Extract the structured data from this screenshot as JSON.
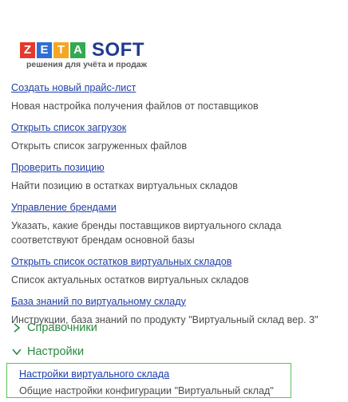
{
  "logo": {
    "letters": [
      "Z",
      "E",
      "T",
      "A"
    ],
    "word": "SOFT",
    "tagline": "решения для учёта и продаж",
    "letter_colors": [
      "#e23b2e",
      "#2e6fd8",
      "#f5a623",
      "#34a853"
    ]
  },
  "items": [
    {
      "link": "Создать новый прайс-лист",
      "desc": "Новая настройка получения файлов от поставщиков"
    },
    {
      "link": "Открыть список загрузок",
      "desc": "Открыть список загруженных файлов"
    },
    {
      "link": "Проверить позицию",
      "desc": "Найти позицию в остатках виртуальных складов"
    },
    {
      "link": "Управление брендами",
      "desc": "Указать, какие бренды поставщиков виртуального склада",
      "desc2": "соответствуют брендам основной базы"
    },
    {
      "link": "Открыть список остатков виртуальных складов",
      "desc": "Список актуальных остатков виртуальных складов"
    },
    {
      "link": "База знаний по виртуальному складу",
      "desc": "Инструкции, база знаний по продукту \"Виртуальный склад вер. 3\""
    }
  ],
  "groups": [
    {
      "label": "Справочники",
      "state": "collapsed"
    },
    {
      "label": "Настройки",
      "state": "expanded"
    }
  ],
  "settings_item": {
    "link": "Настройки виртуального склада",
    "desc": "Общие настройки конфигурации \"Виртуальный склад\""
  },
  "colors": {
    "link": "#1f3faa",
    "group": "#2a8a3e",
    "selection_border": "#5fbf5a"
  }
}
